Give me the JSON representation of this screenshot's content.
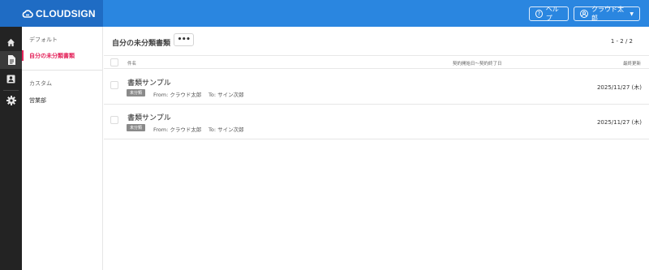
{
  "header": {
    "logo_text": "CLOUDSIGN",
    "help_label": "ヘルプ",
    "user_label": "クラウド太郎"
  },
  "rail": {
    "items": [
      {
        "icon": "home-icon"
      },
      {
        "icon": "document-icon",
        "active": true
      },
      {
        "icon": "contact-card-icon"
      },
      {
        "icon": "gear-icon"
      }
    ]
  },
  "sidebar": {
    "group1": "デフォルト",
    "item_unclassified": "自分の未分類書類",
    "group2": "カスタム",
    "item_sales": "営業部"
  },
  "main": {
    "title": "自分の未分類書類",
    "more_label": "•••",
    "pager": "1 - 2 / 2",
    "columns": {
      "name": "件名",
      "period": "契約開始日〜契約終了日",
      "updated": "最終更新"
    },
    "rows": [
      {
        "title": "書類サンプル",
        "badge": "未分類",
        "from": "From: クラウド太郎",
        "to": "To: サイン次郎",
        "date": "2025/11/27 (木)"
      },
      {
        "title": "書類サンプル",
        "badge": "未分類",
        "from": "From: クラウド太郎",
        "to": "To: サイン次郎",
        "date": "2025/11/27 (木)"
      }
    ]
  },
  "colors": {
    "header_blue": "#2a86e0",
    "logo_blue": "#1f6cc4",
    "accent_pink": "#e4245b",
    "rail_dark": "#232323"
  }
}
